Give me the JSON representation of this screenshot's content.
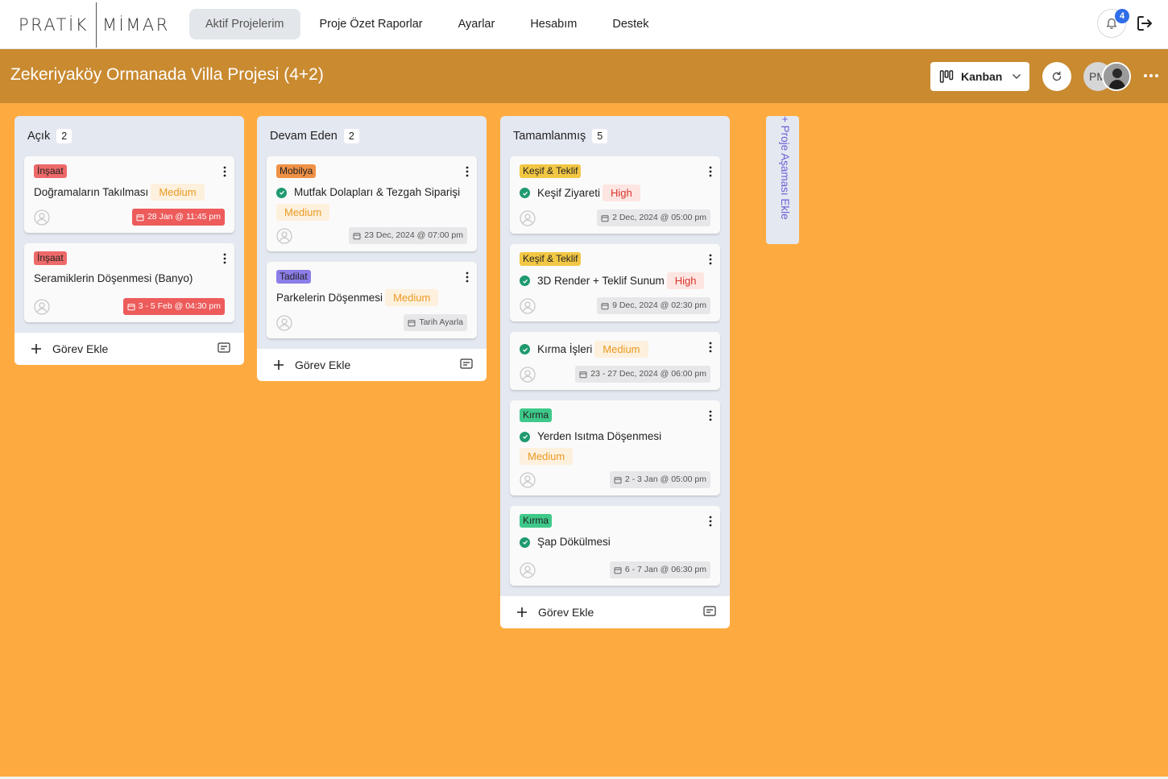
{
  "brand": {
    "part1": "PRATİK",
    "part2": "MİMAR"
  },
  "nav": {
    "items": [
      {
        "label": "Aktif Projelerim",
        "active": true
      },
      {
        "label": "Proje Özet Raporlar"
      },
      {
        "label": "Ayarlar"
      },
      {
        "label": "Hesabım"
      },
      {
        "label": "Destek"
      }
    ],
    "notification_count": "4"
  },
  "project": {
    "title": "Zekeriyaköy Ormanada Villa Projesi (4+2)",
    "view_label": "Kanban",
    "avatar_initials": "PM",
    "header_color": "#c98a30"
  },
  "columns": [
    {
      "name": "Açık",
      "count": "2",
      "add_label": "Görev Ekle",
      "cards": [
        {
          "tag": "İnşaat",
          "tag_color": "#ee6969",
          "title": "Doğramaların Takılması",
          "priority": "Medium",
          "date": "28 Jan @ 11:45 pm",
          "date_style": "red"
        },
        {
          "tag": "İnşaat",
          "tag_color": "#ee6969",
          "title": "Seramiklerin Döşenmesi (Banyo)",
          "date": "3 - 5 Feb @ 04:30 pm",
          "date_style": "red"
        }
      ]
    },
    {
      "name": "Devam Eden",
      "count": "2",
      "add_label": "Görev Ekle",
      "cards": [
        {
          "tag": "Mobilya",
          "tag_color": "#f09146",
          "title": "Mutfak Dolapları & Tezgah Siparişi",
          "checked": true,
          "priority": "Medium",
          "date": "23 Dec, 2024 @ 07:00 pm",
          "date_style": "grey"
        },
        {
          "tag": "Tadilat",
          "tag_color": "#8b7ee8",
          "title": "Parkelerin Döşenmesi",
          "priority": "Medium",
          "date": "Tarih Ayarla",
          "date_style": "grey"
        }
      ]
    },
    {
      "name": "Tamamlanmış",
      "count": "5",
      "add_label": "Görev Ekle",
      "cards": [
        {
          "tag": "Keşif & Teklif",
          "tag_color": "#f2c744",
          "title": "Keşif Ziyareti",
          "checked": true,
          "priority": "High",
          "date": "2 Dec, 2024 @ 05:00 pm",
          "date_style": "grey"
        },
        {
          "tag": "Keşif & Teklif",
          "tag_color": "#f2c744",
          "title": "3D Render + Teklif Sunum",
          "checked": true,
          "priority": "High",
          "date": "9 Dec, 2024 @ 02:30 pm",
          "date_style": "grey"
        },
        {
          "title": "Kırma İşleri",
          "checked": true,
          "priority": "Medium",
          "date": "23 - 27 Dec, 2024 @ 06:00 pm",
          "date_style": "grey"
        },
        {
          "tag": "Kırma",
          "tag_color": "#3ec98a",
          "title": "Yerden Isıtma Döşenmesi",
          "checked": true,
          "priority": "Medium",
          "date": "2 - 3 Jan @ 05:00 pm",
          "date_style": "grey"
        },
        {
          "tag": "Kırma",
          "tag_color": "#3ec98a",
          "title": "Şap Dökülmesi",
          "checked": true,
          "date": "6 - 7 Jan @ 06:30 pm",
          "date_style": "grey"
        }
      ]
    }
  ],
  "add_stage_label": "+ Proje Aşaması Ekle",
  "colors": {
    "background": "#fdab41",
    "column": "#e4e8f0",
    "accent": "#2f6dea",
    "done_check": "#1f9a6f"
  }
}
